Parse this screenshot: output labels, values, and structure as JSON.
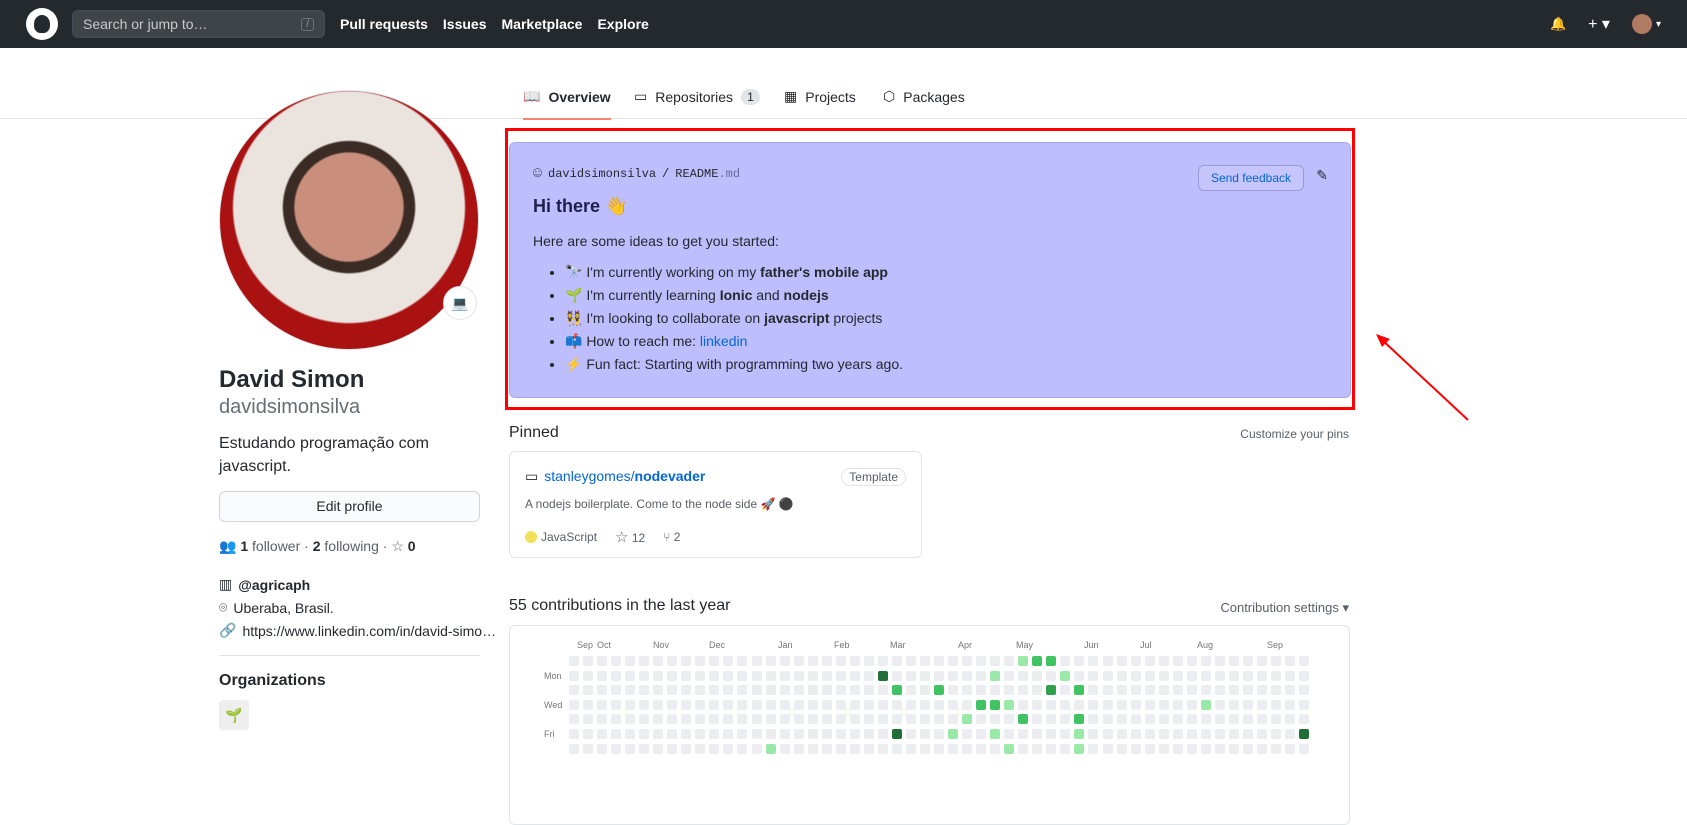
{
  "header": {
    "search_placeholder": "Search or jump to…",
    "slash": "/",
    "nav": [
      "Pull requests",
      "Issues",
      "Marketplace",
      "Explore"
    ],
    "bell": "🔔",
    "plus": "+ ▾",
    "avatar_caret": "▾"
  },
  "tabs": [
    {
      "label": "Overview",
      "icon": "📖"
    },
    {
      "label": "Repositories",
      "icon": "▭",
      "count": "1"
    },
    {
      "label": "Projects",
      "icon": "▦"
    },
    {
      "label": "Packages",
      "icon": "⬡"
    }
  ],
  "profile": {
    "status_emoji": "💻",
    "name": "David Simon",
    "login": "davidsimonsilva",
    "bio": "Estudando programação com javascript.",
    "edit": "Edit profile",
    "followers": "1",
    "followers_label": "follower",
    "following": "2",
    "following_label": "following",
    "stars": "0",
    "org": "@agricaph",
    "location": "Uberaba, Brasil.",
    "website": "https://www.linkedin.com/in/david-simo…",
    "orgs_heading": "Organizations",
    "org_avatar": "🌱"
  },
  "readme": {
    "user": "davidsimonsilva",
    "sep": "/",
    "file": "README",
    "ext": ".md",
    "feedback": "Send feedback",
    "title": "Hi there 👋",
    "intro": "Here are some ideas to get you started:",
    "items": [
      {
        "pre": "🔭 I'm currently working on my ",
        "b": "father's mobile app"
      },
      {
        "pre": "🌱 I'm currently learning ",
        "b": "Ionic",
        "mid": " and ",
        "b2": "nodejs"
      },
      {
        "pre": "👯 I'm looking to collaborate on ",
        "b": "javascript",
        "post": " projects"
      },
      {
        "pre": "📫 How to reach me: ",
        "link": "linkedin"
      },
      {
        "pre": "⚡ Fun fact: Starting with programming two years ago."
      }
    ]
  },
  "pinned": {
    "heading": "Pinned",
    "customize": "Customize your pins",
    "repo_owner": "stanleygomes/",
    "repo_name": "nodevader",
    "badge": "Template",
    "desc": "A nodejs boilerplate. Come to the node side 🚀 ⚫",
    "lang": "JavaScript",
    "lang_color": "#f1e05a",
    "stars": "12",
    "forks": "2"
  },
  "contrib": {
    "heading": "55 contributions in the last year",
    "settings": "Contribution settings ▾",
    "months": [
      "Sep",
      "Oct",
      "Nov",
      "Dec",
      "Jan",
      "Feb",
      "Mar",
      "Apr",
      "May",
      "Jun",
      "Jul",
      "Aug",
      "Sep"
    ],
    "days": [
      "Mon",
      "Wed",
      "Fri"
    ],
    "colors": [
      "#ebedf0",
      "#9be9a8",
      "#40c463",
      "#30a14e",
      "#216e39"
    ],
    "cells": [
      [
        32,
        0,
        1
      ],
      [
        33,
        0,
        2
      ],
      [
        34,
        0,
        2
      ],
      [
        22,
        1,
        4
      ],
      [
        30,
        1,
        1
      ],
      [
        35,
        1,
        1
      ],
      [
        23,
        2,
        2
      ],
      [
        26,
        2,
        2
      ],
      [
        34,
        2,
        3
      ],
      [
        36,
        2,
        2
      ],
      [
        29,
        3,
        2
      ],
      [
        30,
        3,
        2
      ],
      [
        31,
        3,
        1
      ],
      [
        45,
        3,
        1
      ],
      [
        28,
        4,
        1
      ],
      [
        32,
        4,
        2
      ],
      [
        36,
        4,
        2
      ],
      [
        23,
        5,
        4
      ],
      [
        27,
        5,
        1
      ],
      [
        30,
        5,
        1
      ],
      [
        36,
        5,
        1
      ],
      [
        52,
        5,
        4
      ],
      [
        14,
        6,
        1
      ],
      [
        31,
        6,
        1
      ],
      [
        36,
        6,
        1
      ]
    ]
  }
}
